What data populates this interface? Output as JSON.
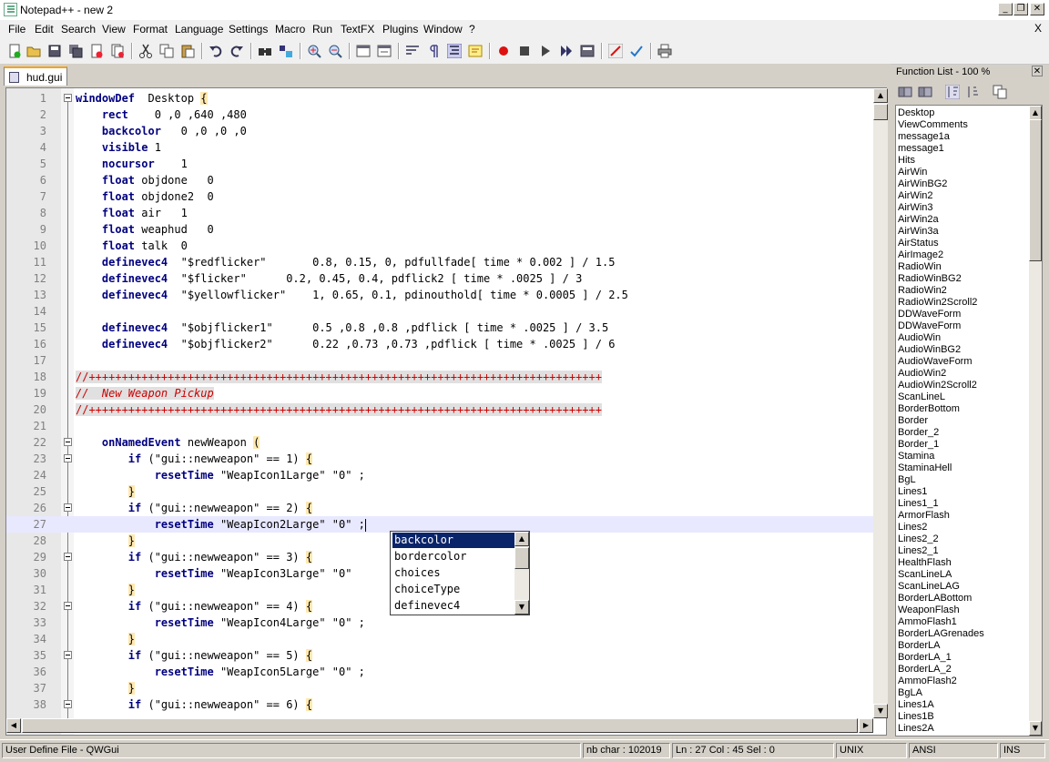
{
  "window": {
    "title": "Notepad++ - new 2",
    "min_glyph": "_",
    "max_glyph": "❐",
    "close_glyph": "✕"
  },
  "menu": {
    "items": [
      "File",
      "Edit",
      "Search",
      "View",
      "Format",
      "Language",
      "Settings",
      "Macro",
      "Run",
      "TextFX",
      "Plugins",
      "Window",
      "?"
    ],
    "close": "X"
  },
  "tabs": [
    {
      "label": "hud.gui",
      "active": true
    }
  ],
  "editor": {
    "current_line": 27,
    "lines": [
      {
        "n": "1",
        "fold": "minus",
        "segs": [
          [
            "kw",
            "windowDef"
          ],
          [
            "",
            "  Desktop "
          ],
          [
            "brace",
            "{"
          ]
        ]
      },
      {
        "n": "2",
        "segs": [
          [
            "",
            "    "
          ],
          [
            "kw",
            "rect"
          ],
          [
            "",
            "    0 ,0 ,640 ,480"
          ]
        ]
      },
      {
        "n": "3",
        "segs": [
          [
            "",
            "    "
          ],
          [
            "kw",
            "backcolor"
          ],
          [
            "",
            "   0 ,0 ,0 ,0"
          ]
        ]
      },
      {
        "n": "4",
        "segs": [
          [
            "",
            "    "
          ],
          [
            "kw",
            "visible"
          ],
          [
            "",
            " 1"
          ]
        ]
      },
      {
        "n": "5",
        "segs": [
          [
            "",
            "    "
          ],
          [
            "kw",
            "nocursor"
          ],
          [
            "",
            "    1"
          ]
        ]
      },
      {
        "n": "6",
        "segs": [
          [
            "",
            "    "
          ],
          [
            "kw",
            "float"
          ],
          [
            "",
            " objdone   0"
          ]
        ]
      },
      {
        "n": "7",
        "segs": [
          [
            "",
            "    "
          ],
          [
            "kw",
            "float"
          ],
          [
            "",
            " objdone2  0"
          ]
        ]
      },
      {
        "n": "8",
        "segs": [
          [
            "",
            "    "
          ],
          [
            "kw",
            "float"
          ],
          [
            "",
            " air   1"
          ]
        ]
      },
      {
        "n": "9",
        "segs": [
          [
            "",
            "    "
          ],
          [
            "kw",
            "float"
          ],
          [
            "",
            " weaphud   0"
          ]
        ]
      },
      {
        "n": "10",
        "segs": [
          [
            "",
            "    "
          ],
          [
            "kw",
            "float"
          ],
          [
            "",
            " talk  0"
          ]
        ]
      },
      {
        "n": "11",
        "segs": [
          [
            "",
            "    "
          ],
          [
            "kw",
            "definevec4"
          ],
          [
            "",
            "  \"$redflicker\"       0.8, 0.15, 0, pdfullfade[ time * 0.002 ] / 1.5"
          ]
        ]
      },
      {
        "n": "12",
        "segs": [
          [
            "",
            "    "
          ],
          [
            "kw",
            "definevec4"
          ],
          [
            "",
            "  \"$flicker\"      0.2, 0.45, 0.4, pdflick2 [ time * .0025 ] / 3"
          ]
        ]
      },
      {
        "n": "13",
        "segs": [
          [
            "",
            "    "
          ],
          [
            "kw",
            "definevec4"
          ],
          [
            "",
            "  \"$yellowflicker\"    1, 0.65, 0.1, pdinouthold[ time * 0.0005 ] / 2.5"
          ]
        ]
      },
      {
        "n": "14",
        "segs": []
      },
      {
        "n": "15",
        "segs": [
          [
            "",
            "    "
          ],
          [
            "kw",
            "definevec4"
          ],
          [
            "",
            "  \"$objflicker1\"      0.5 ,0.8 ,0.8 ,pdflick [ time * .0025 ] / 3.5"
          ]
        ]
      },
      {
        "n": "16",
        "segs": [
          [
            "",
            "    "
          ],
          [
            "kw",
            "definevec4"
          ],
          [
            "",
            "  \"$objflicker2\"      0.22 ,0.73 ,0.73 ,pdflick [ time * .0025 ] / 6"
          ]
        ]
      },
      {
        "n": "17",
        "segs": []
      },
      {
        "n": "18",
        "segs": [
          [
            "cmtp",
            "//++++++++++++++++++++++++++++++++++++++++++++++++++++++++++++++++++++++++++++++"
          ]
        ]
      },
      {
        "n": "19",
        "segs": [
          [
            "cmt",
            "//  New Weapon Pickup"
          ]
        ]
      },
      {
        "n": "20",
        "segs": [
          [
            "cmtp",
            "//++++++++++++++++++++++++++++++++++++++++++++++++++++++++++++++++++++++++++++++"
          ]
        ]
      },
      {
        "n": "21",
        "segs": []
      },
      {
        "n": "22",
        "fold": "minus",
        "segs": [
          [
            "",
            "    "
          ],
          [
            "kw",
            "onNamedEvent"
          ],
          [
            "",
            " newWeapon "
          ],
          [
            "brace",
            "("
          ]
        ]
      },
      {
        "n": "23",
        "fold": "minus",
        "segs": [
          [
            "",
            "        "
          ],
          [
            "kw",
            "if"
          ],
          [
            "",
            " (\"gui::newweapon\" == 1) "
          ],
          [
            "brace",
            "{"
          ]
        ]
      },
      {
        "n": "24",
        "segs": [
          [
            "",
            "            "
          ],
          [
            "kw",
            "resetTime"
          ],
          [
            "",
            " \"WeapIcon1Large\" \"0\" ;"
          ]
        ]
      },
      {
        "n": "25",
        "segs": [
          [
            "",
            "        "
          ],
          [
            "brace",
            "}"
          ]
        ]
      },
      {
        "n": "26",
        "fold": "minus",
        "segs": [
          [
            "",
            "        "
          ],
          [
            "kw",
            "if"
          ],
          [
            "",
            " (\"gui::newweapon\" == 2) "
          ],
          [
            "brace",
            "{"
          ]
        ]
      },
      {
        "n": "27",
        "segs": [
          [
            "",
            "            "
          ],
          [
            "kw",
            "resetTime"
          ],
          [
            "",
            " \"WeapIcon2Large\" \"0\" ;"
          ],
          [
            "caret",
            ""
          ]
        ]
      },
      {
        "n": "28",
        "segs": [
          [
            "",
            "        "
          ],
          [
            "brace",
            "}"
          ]
        ]
      },
      {
        "n": "29",
        "fold": "minus",
        "segs": [
          [
            "",
            "        "
          ],
          [
            "kw",
            "if"
          ],
          [
            "",
            " (\"gui::newweapon\" == 3) "
          ],
          [
            "brace",
            "{"
          ]
        ]
      },
      {
        "n": "30",
        "segs": [
          [
            "",
            "            "
          ],
          [
            "kw",
            "resetTime"
          ],
          [
            "",
            " \"WeapIcon3Large\" \"0\""
          ]
        ]
      },
      {
        "n": "31",
        "segs": [
          [
            "",
            "        "
          ],
          [
            "brace",
            "}"
          ]
        ]
      },
      {
        "n": "32",
        "fold": "minus",
        "segs": [
          [
            "",
            "        "
          ],
          [
            "kw",
            "if"
          ],
          [
            "",
            " (\"gui::newweapon\" == 4) "
          ],
          [
            "brace",
            "{"
          ]
        ]
      },
      {
        "n": "33",
        "segs": [
          [
            "",
            "            "
          ],
          [
            "kw",
            "resetTime"
          ],
          [
            "",
            " \"WeapIcon4Large\" \"0\" ;"
          ]
        ]
      },
      {
        "n": "34",
        "segs": [
          [
            "",
            "        "
          ],
          [
            "brace",
            "}"
          ]
        ]
      },
      {
        "n": "35",
        "fold": "minus",
        "segs": [
          [
            "",
            "        "
          ],
          [
            "kw",
            "if"
          ],
          [
            "",
            " (\"gui::newweapon\" == 5) "
          ],
          [
            "brace",
            "{"
          ]
        ]
      },
      {
        "n": "36",
        "segs": [
          [
            "",
            "            "
          ],
          [
            "kw",
            "resetTime"
          ],
          [
            "",
            " \"WeapIcon5Large\" \"0\" ;"
          ]
        ]
      },
      {
        "n": "37",
        "segs": [
          [
            "",
            "        "
          ],
          [
            "brace",
            "}"
          ]
        ]
      },
      {
        "n": "38",
        "fold": "minus",
        "segs": [
          [
            "",
            "        "
          ],
          [
            "kw",
            "if"
          ],
          [
            "",
            " (\"gui::newweapon\" == 6) "
          ],
          [
            "brace",
            "{"
          ]
        ]
      }
    ]
  },
  "autocomplete": {
    "items": [
      "backcolor",
      "bordercolor",
      "choices",
      "choiceType",
      "definevec4"
    ],
    "selected": 0
  },
  "function_list": {
    "title": "Function List - 100 %",
    "close": "✕",
    "items": [
      "Desktop",
      "ViewComments",
      "message1a",
      "message1",
      "Hits",
      "AirWin",
      "AirWinBG2",
      "AirWin2",
      "AirWin3",
      "AirWin2a",
      "AirWin3a",
      "AirStatus",
      "AirImage2",
      "RadioWin",
      "RadioWinBG2",
      "RadioWin2",
      "RadioWin2Scroll2",
      "DDWaveForm",
      "DDWaveForm",
      "AudioWin",
      "AudioWinBG2",
      "AudioWaveForm",
      "AudioWin2",
      "AudioWin2Scroll2",
      "ScanLineL",
      "BorderBottom",
      "Border",
      "Border_2",
      "Border_1",
      "Stamina",
      "StaminaHell",
      "BgL",
      "Lines1",
      "Lines1_1",
      "ArmorFlash",
      "Lines2",
      "Lines2_2",
      "Lines2_1",
      "HealthFlash",
      "ScanLineLA",
      "ScanLineLAG",
      "BorderLABottom",
      "WeaponFlash",
      "AmmoFlash1",
      "BorderLAGrenades",
      "BorderLA",
      "BorderLA_1",
      "BorderLA_2",
      "AmmoFlash2",
      "BgLA",
      "Lines1A",
      "Lines1B",
      "Lines2A"
    ]
  },
  "status": {
    "filetype": "User Define File - QWGui",
    "nbchar": "nb char : 102019",
    "position": "Ln : 27    Col : 45    Sel : 0",
    "eol": "UNIX",
    "encoding": "ANSI",
    "mode": "INS"
  },
  "scroll_arrows": {
    "up": "▲",
    "down": "▼",
    "left": "◀",
    "right": "▶"
  }
}
